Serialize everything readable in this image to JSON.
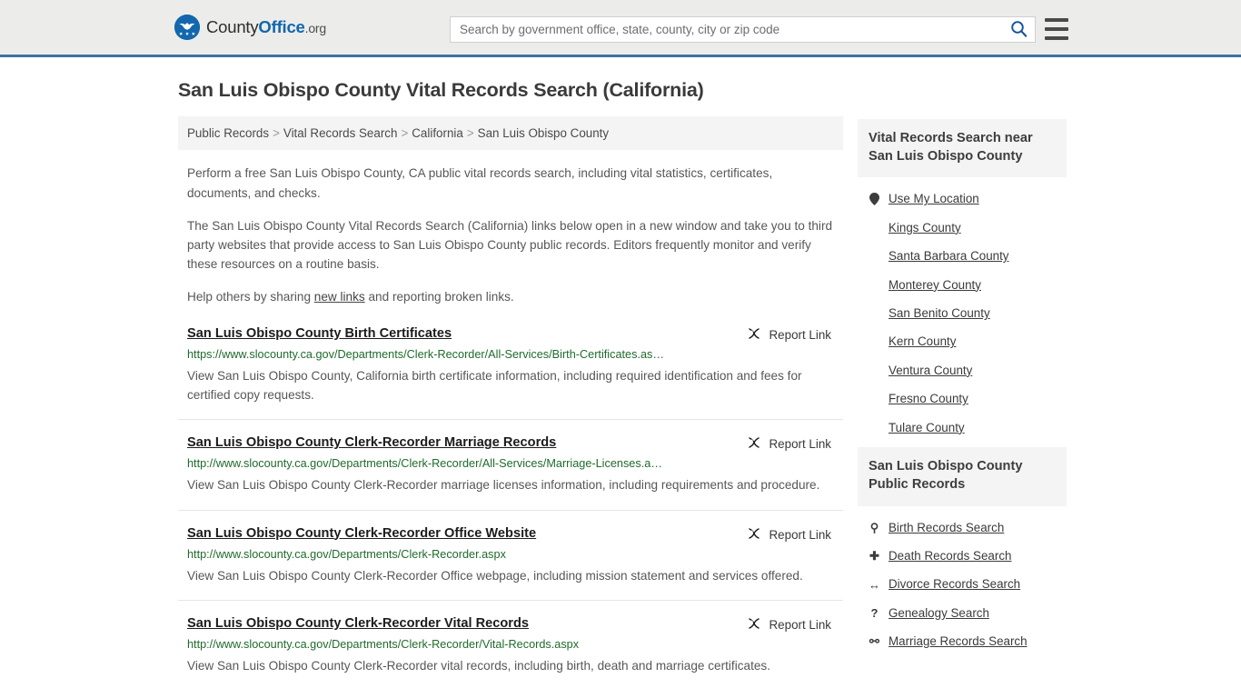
{
  "header": {
    "logo": {
      "prefix": "County",
      "bold": "Office",
      "suffix": ".org",
      "icon": "eagle-seal-icon"
    },
    "search": {
      "placeholder": "Search by government office, state, county, city or zip code",
      "value": "",
      "icon": "search-icon"
    },
    "menu_icon": "hamburger-menu-icon",
    "accent_color": "#3d72a4",
    "background": "#ececeb"
  },
  "main": {
    "page_title": "San Luis Obispo County Vital Records Search (California)",
    "breadcrumb": [
      "Public Records",
      "Vital Records Search",
      "California",
      "San Luis Obispo County"
    ],
    "breadcrumb_separator": ">",
    "intro": {
      "p1": "Perform a free San Luis Obispo County, CA public vital records search, including vital statistics, certificates, documents, and checks.",
      "p2": "The San Luis Obispo County Vital Records Search (California) links below open in a new window and take you to third party websites that provide access to San Luis Obispo County public records. Editors frequently monitor and verify these resources on a routine basis.",
      "p3_before": "Help others by sharing ",
      "p3_link": "new links",
      "p3_after": " and reporting broken links."
    },
    "report_link_label": "Report Link",
    "report_link_icon": "broken-link-icon",
    "results": [
      {
        "title": "San Luis Obispo County Birth Certificates",
        "url": "https://www.slocounty.ca.gov/Departments/Clerk-Recorder/All-Services/Birth-Certificates.as…",
        "description": "View San Luis Obispo County, California birth certificate information, including required identification and fees for certified copy requests."
      },
      {
        "title": "San Luis Obispo County Clerk-Recorder Marriage Records",
        "url": "http://www.slocounty.ca.gov/Departments/Clerk-Recorder/All-Services/Marriage-Licenses.a…",
        "description": "View San Luis Obispo County Clerk-Recorder marriage licenses information, including requirements and procedure."
      },
      {
        "title": "San Luis Obispo County Clerk-Recorder Office Website",
        "url": "http://www.slocounty.ca.gov/Departments/Clerk-Recorder.aspx",
        "description": "View San Luis Obispo County Clerk-Recorder Office webpage, including mission statement and services offered."
      },
      {
        "title": "San Luis Obispo County Clerk-Recorder Vital Records",
        "url": "http://www.slocounty.ca.gov/Departments/Clerk-Recorder/Vital-Records.aspx",
        "description": "View San Luis Obispo County Clerk-Recorder vital records, including birth, death and marriage certificates."
      }
    ]
  },
  "sidebar": {
    "nearby": {
      "heading": "Vital Records Search near San Luis Obispo County",
      "items": [
        {
          "label": "Use My Location",
          "icon": "map-pin-icon"
        },
        {
          "label": "Kings County",
          "icon": ""
        },
        {
          "label": "Santa Barbara County",
          "icon": ""
        },
        {
          "label": "Monterey County",
          "icon": ""
        },
        {
          "label": "San Benito County",
          "icon": ""
        },
        {
          "label": "Kern County",
          "icon": ""
        },
        {
          "label": "Ventura County",
          "icon": ""
        },
        {
          "label": "Fresno County",
          "icon": ""
        },
        {
          "label": "Tulare County",
          "icon": ""
        }
      ]
    },
    "public_records": {
      "heading": "San Luis Obispo County Public Records",
      "items": [
        {
          "label": "Birth Records Search",
          "icon": "baby-icon",
          "glyph": "⚲"
        },
        {
          "label": "Death Records Search",
          "icon": "cross-icon",
          "glyph": "✚"
        },
        {
          "label": "Divorce Records Search",
          "icon": "left-right-arrow-icon",
          "glyph": "↔"
        },
        {
          "label": "Genealogy Search",
          "icon": "question-mark-icon",
          "glyph": "?"
        },
        {
          "label": "Marriage Records Search",
          "icon": "male-female-icon",
          "glyph": "⚯"
        }
      ]
    }
  }
}
